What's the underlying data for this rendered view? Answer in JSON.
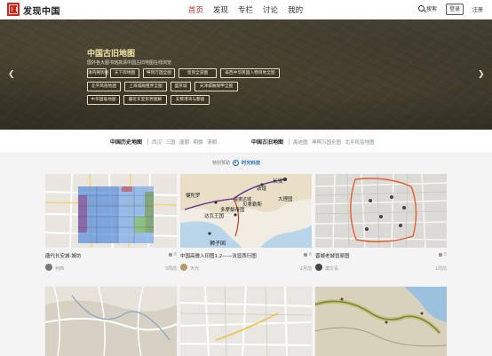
{
  "header": {
    "logo_text": "发现中国",
    "nav": [
      {
        "label": "首页",
        "active": true
      },
      {
        "label": "发现",
        "active": false
      },
      {
        "label": "专栏",
        "active": false
      },
      {
        "label": "讨论",
        "active": false
      },
      {
        "label": "我的",
        "active": false
      }
    ],
    "search_label": "搜索",
    "login_label": "登录",
    "register_label": "注册",
    "accent_color": "#c0392b"
  },
  "hero": {
    "title": "中国古旧地图",
    "subtitle": "国外各大图书馆高清中国古旧地图在线浏览",
    "prev_icon": "chevron-left-icon",
    "next_icon": "chevron-right-icon",
    "tags": [
      "清内阁舆图",
      "天下舆地图",
      "坤舆万国全图",
      "皇舆全览图",
      "泰西中华民国人物舆地全图",
      "北平风俗地图",
      "上海城厢租界全图",
      "盛京城",
      "天津城厢保甲全图",
      "中华国耻地图",
      "最近东亚形势图解",
      "支那港湾与都督"
    ]
  },
  "categories": {
    "history": {
      "heading": "中国历史地图",
      "items": [
        "西汉",
        "三国",
        "唐朝",
        "明朝",
        "清朝"
      ]
    },
    "ancient": {
      "heading": "中国古旧地图",
      "items": [
        "禹迹图",
        "坤舆万国全图",
        "北平风俗地图"
      ]
    }
  },
  "sponsor": {
    "label": "特别赞助",
    "name": "时光科技"
  },
  "cards": [
    {
      "title": "唐代长安城·城坊",
      "likes": "6",
      "author": "何西",
      "time": "3周前",
      "thumb_icon": "map-thumbnail-icon"
    },
    {
      "title": "中国高僧入印图1.2——法显西行图",
      "likes": "6",
      "author": "天光",
      "time": "2月前",
      "thumb_icon": "map-thumbnail-icon"
    },
    {
      "title": "晋城老城冒原图",
      "likes": "5",
      "author": "廉文青",
      "time": "1周前",
      "thumb_icon": "map-thumbnail-icon"
    },
    {
      "thumb_icon": "map-thumbnail-icon"
    },
    {
      "thumb_icon": "map-thumbnail-icon"
    },
    {
      "thumb_icon": "map-thumbnail-icon"
    }
  ],
  "map_labels": {
    "card2": [
      "长安",
      "敦煌",
      "犍陀罗",
      "达瓦王国",
      "贝拿勒斯",
      "多摩梨帝国",
      "狮子国",
      "提婆达城",
      "大理国"
    ]
  }
}
